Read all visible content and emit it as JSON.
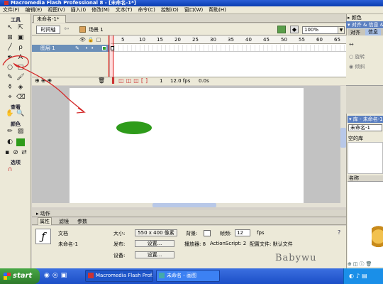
{
  "window": {
    "title": "Macromedia Flash Professional 8 - [未命名-1*]"
  },
  "menu": [
    "文件(F)",
    "编辑(E)",
    "视图(V)",
    "插入(I)",
    "修改(M)",
    "文本(T)",
    "命令(C)",
    "控制(O)",
    "窗口(W)",
    "帮助(H)"
  ],
  "tools": {
    "title": "工具",
    "view_label": "查看",
    "colors_label": "颜色",
    "options_label": "选项"
  },
  "document": {
    "tab": "未命名-1*",
    "timeline_button": "时间轴",
    "scene": "场景 1",
    "zoom": "100%"
  },
  "timeline": {
    "layer_name": "图层 1",
    "ruler": [
      "5",
      "10",
      "15",
      "20",
      "25",
      "30",
      "35",
      "40",
      "45",
      "50",
      "55",
      "60",
      "65"
    ],
    "current_frame": "1",
    "fps": "12.0 fps",
    "elapsed": "0.0s"
  },
  "panels": {
    "actions": "动作",
    "tabs": [
      "属性",
      "滤镜",
      "参数"
    ],
    "doc_type": "文档",
    "doc_name": "未命名-1",
    "size_label": "大小:",
    "size_value": "550 x 400 像素",
    "bg_label": "背景:",
    "fps_label": "帧频:",
    "fps_value": "12",
    "fps_unit": "fps",
    "publish_label": "发布:",
    "settings_button": "设置...",
    "player_text": "播放器: 8",
    "actionscript_text": "ActionScript: 2",
    "profile_text": "配置文件: 默认文件",
    "device_label": "设备:",
    "device_button": "设置..."
  },
  "right": {
    "color_header": "颜色",
    "align_header": "对齐 & 信息 & 变形",
    "align_tabs": [
      "对齐",
      "信息"
    ],
    "align_opt1": "旋转",
    "align_opt2": "倾斜",
    "library_header": "库 - 未命名-1",
    "library_select": "未命名-1",
    "library_empty": "空的库",
    "library_col": "名称"
  },
  "taskbar": {
    "start": "start",
    "tasks": [
      "Macromedia Flash Prof...",
      "未命名 - 画图"
    ]
  },
  "watermark": "Babywu",
  "colors": {
    "ellipse": "#2e9b1a",
    "layer_highlight": "#6b8fb8",
    "panel_header": "#5b7fc0",
    "annotation": "#d42a2a"
  }
}
